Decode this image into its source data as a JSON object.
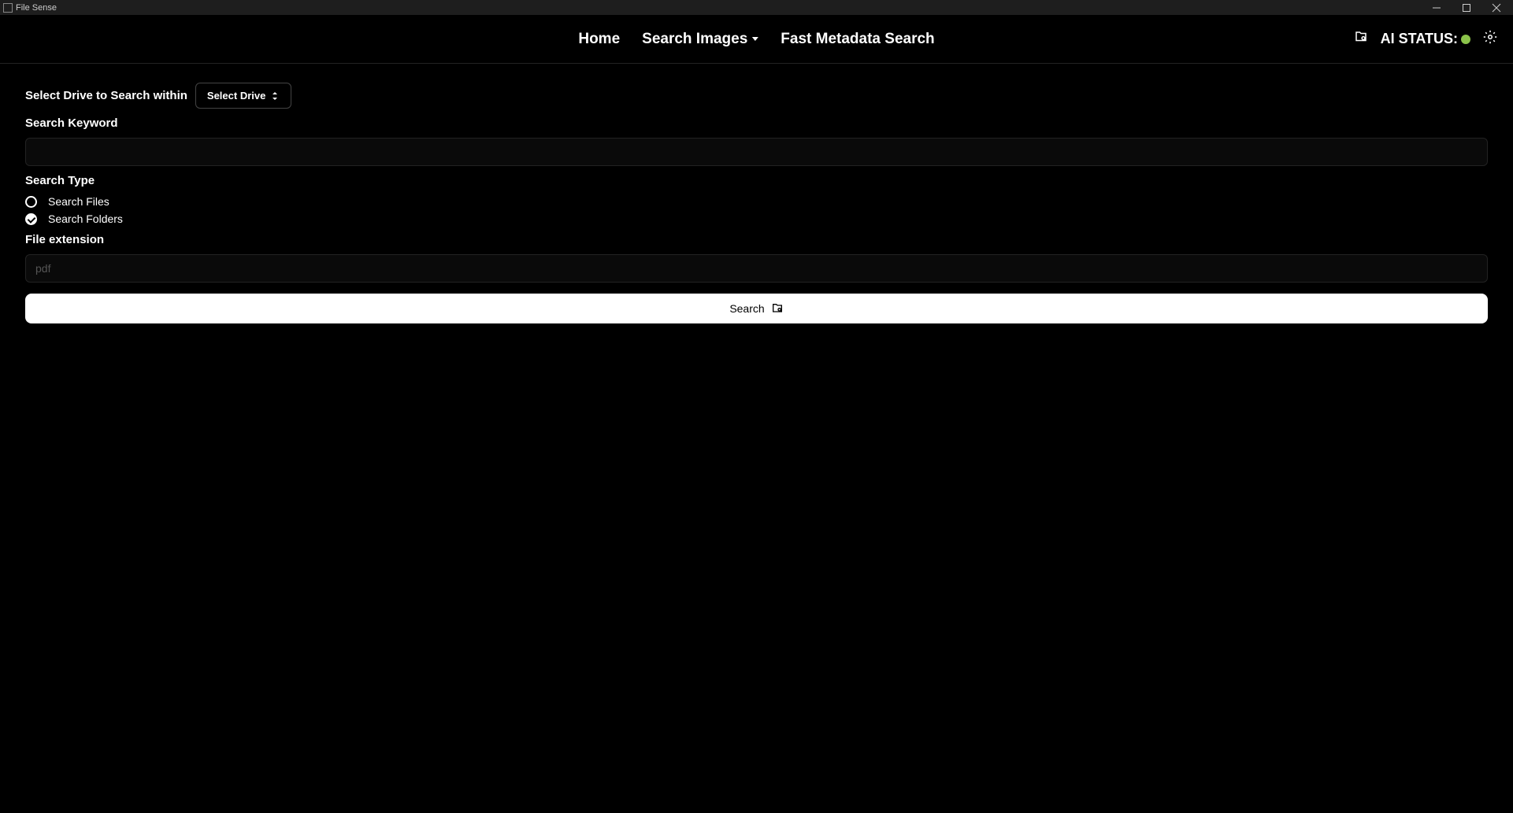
{
  "window": {
    "title": "File Sense"
  },
  "nav": {
    "home": "Home",
    "search_images": "Search Images",
    "fast_metadata": "Fast Metadata Search",
    "ai_status_label": "AI STATUS:"
  },
  "form": {
    "drive_label": "Select Drive to Search within",
    "drive_button": "Select Drive",
    "keyword_label": "Search Keyword",
    "keyword_value": "",
    "search_type_label": "Search Type",
    "radio_files": "Search Files",
    "radio_folders": "Search Folders",
    "extension_label": "File extension",
    "extension_placeholder": "pdf",
    "extension_value": "",
    "search_button": "Search"
  }
}
